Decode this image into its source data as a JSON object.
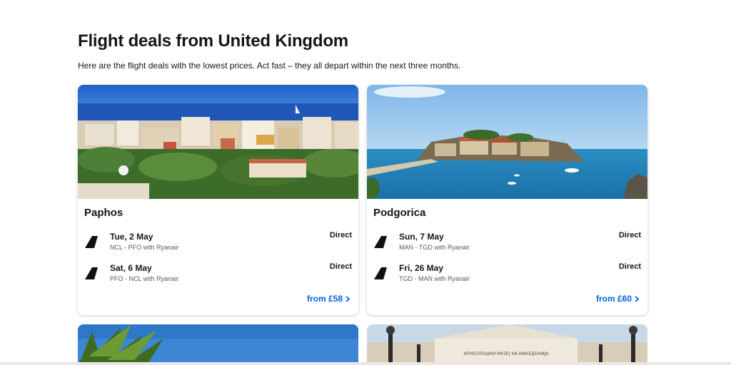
{
  "header": {
    "title": "Flight deals from United Kingdom",
    "subtitle": "Here are the flight deals with the lowest prices. Act fast – they all depart within the next three months."
  },
  "deals": [
    {
      "city": "Paphos",
      "outbound": {
        "date": "Tue, 2 May",
        "route": "NCL - PFO with Ryanair",
        "stops": "Direct"
      },
      "inbound": {
        "date": "Sat, 6 May",
        "route": "PFO - NCL with Ryanair",
        "stops": "Direct"
      },
      "price": "from £58"
    },
    {
      "city": "Podgorica",
      "outbound": {
        "date": "Sun, 7 May",
        "route": "MAN - TGD with Ryanair",
        "stops": "Direct"
      },
      "inbound": {
        "date": "Fri, 26 May",
        "route": "TGD - MAN with Ryanair",
        "stops": "Direct"
      },
      "price": "from £60"
    }
  ],
  "bottom_cards": [
    {
      "sign": "АРХЕОЛОШКИ МУЗЕЈ НА МАКЕДОНИЈА"
    }
  ],
  "colors": {
    "link": "#0062e3",
    "text": "#161616",
    "muted": "#545860"
  },
  "icons": {
    "airline": "airline-tail-icon",
    "chevron": "chevron-right-icon"
  }
}
